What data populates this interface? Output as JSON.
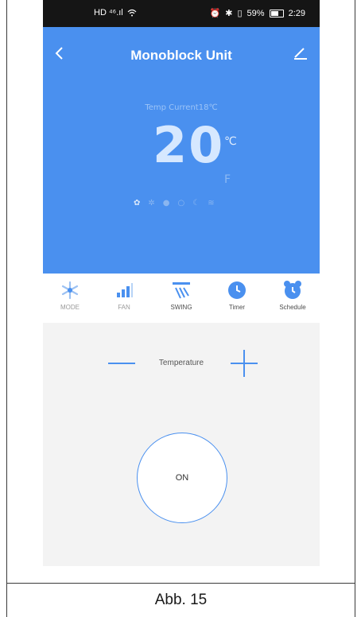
{
  "status_bar": {
    "left": "HD ⁴⁶.ıl",
    "right_battery_pct": "59%",
    "time": "2:29"
  },
  "header": {
    "back_icon": "chevron-left-icon",
    "title": "Monoblock Unit",
    "edit_icon": "pencil-icon"
  },
  "display": {
    "temp_current_label": "Temp Current18℃",
    "set_temp": "20",
    "unit_c": "℃",
    "unit_f": "F",
    "mode_icons": [
      "gear-icon",
      "fan-icon",
      "drop-icon",
      "circle-icon",
      "moon-icon",
      "wave-icon"
    ]
  },
  "tabs": [
    {
      "label": "MODE",
      "icon": "snowflake-icon"
    },
    {
      "label": "FAN",
      "icon": "signal-bars-icon"
    },
    {
      "label": "SWING",
      "icon": "swing-icon"
    },
    {
      "label": "Timer",
      "icon": "clock-icon"
    },
    {
      "label": "Schedule",
      "icon": "alarm-clock-icon"
    }
  ],
  "control": {
    "temperature_label": "Temperature",
    "power_label": "ON"
  },
  "caption": "Abb. 15",
  "colors": {
    "accent": "#4a90ef",
    "status_bar": "#151515",
    "panel": "#f3f3f3"
  }
}
